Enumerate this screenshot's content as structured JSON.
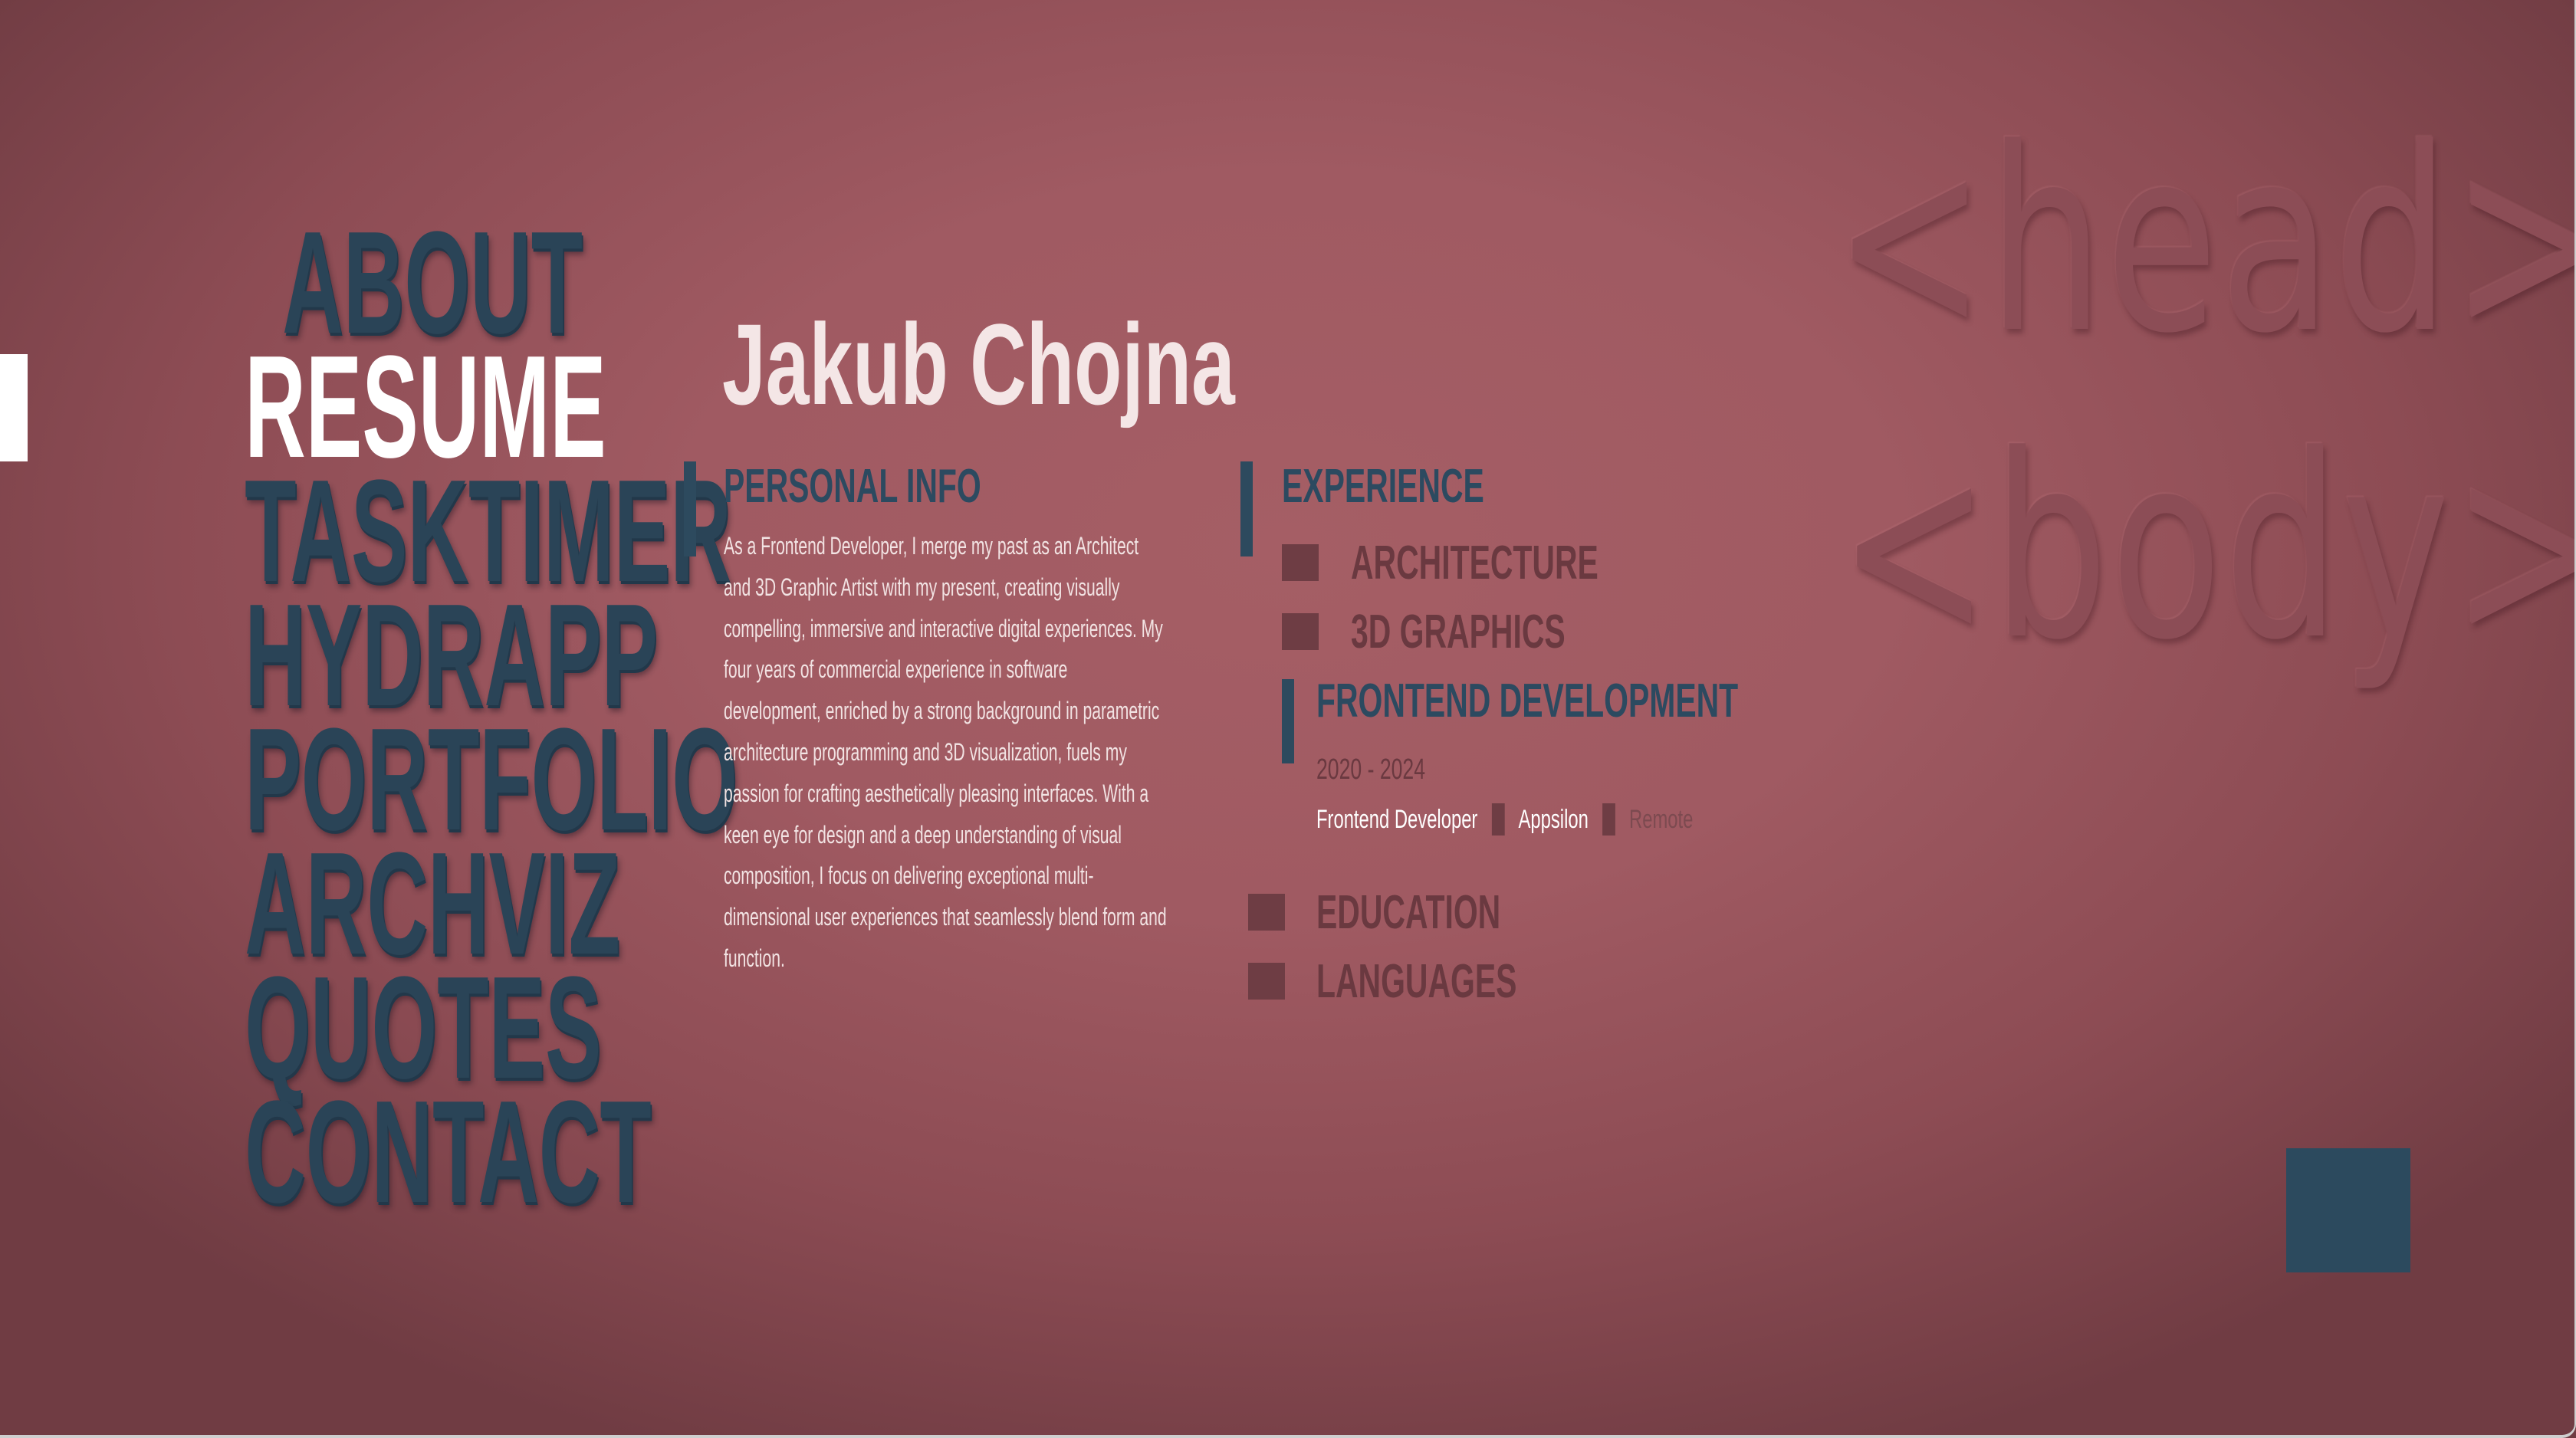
{
  "background_tags": {
    "head": "<head>",
    "body": "<body>"
  },
  "nav": {
    "items": [
      {
        "label": "ABOUT"
      },
      {
        "label": "RESUME"
      },
      {
        "label": "TASKTIMER"
      },
      {
        "label": "HYDRAPP"
      },
      {
        "label": "PORTFOLIO"
      },
      {
        "label": "ARCHVIZ"
      },
      {
        "label": "QUOTES"
      },
      {
        "label": "CONTACT"
      }
    ],
    "active": "RESUME"
  },
  "resume": {
    "name": "Jakub Chojna",
    "personal_info": {
      "title": "PERSONAL INFO",
      "text": "As a Frontend Developer, I merge my past as an Architect and 3D Graphic Artist with my present, creating visually compelling, immersive and interactive digital experiences. My four years of commercial experience in software development, enriched by a strong background in parametric architecture programming and 3D visualization, fuels my passion for crafting aesthetically pleasing interfaces. With a keen eye for design and a deep understanding of visual composition, I focus on delivering exceptional multi-dimensional user experiences that seamlessly blend form and function."
    },
    "experience": {
      "title": "EXPERIENCE",
      "items": [
        {
          "label": "ARCHITECTURE"
        },
        {
          "label": "3D GRAPHICS"
        }
      ],
      "active_item": {
        "label": "FRONTEND DEVELOPMENT",
        "years": "2020 - 2024",
        "role": "Frontend Developer",
        "company": "Appsilon",
        "place": "Remote"
      }
    },
    "other_sections": [
      {
        "label": "EDUCATION"
      },
      {
        "label": "LANGUAGES"
      }
    ]
  },
  "colors": {
    "background": "#a05a62",
    "nav_text": "#2a4457",
    "active_text": "#ffffff",
    "accent_blue": "#2c4a5e",
    "muted_square": "#6e3d44"
  }
}
